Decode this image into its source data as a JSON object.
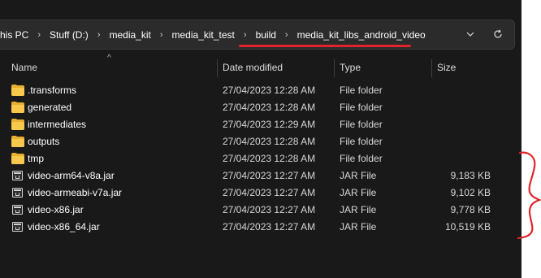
{
  "breadcrumb": {
    "items": [
      "his PC",
      "Stuff (D:)",
      "media_kit",
      "media_kit_test",
      "build",
      "media_kit_libs_android_video"
    ],
    "separator": "›"
  },
  "addressbar": {
    "dropdown_icon": "chevron-down-icon",
    "refresh_icon": "refresh-icon"
  },
  "columns": {
    "name": "Name",
    "date": "Date modified",
    "type": "Type",
    "size": "Size"
  },
  "files": [
    {
      "name": ".transforms",
      "date": "27/04/2023 12:28 AM",
      "type": "File folder",
      "size": "",
      "icon": "folder-icon"
    },
    {
      "name": "generated",
      "date": "27/04/2023 12:28 AM",
      "type": "File folder",
      "size": "",
      "icon": "folder-icon"
    },
    {
      "name": "intermediates",
      "date": "27/04/2023 12:29 AM",
      "type": "File folder",
      "size": "",
      "icon": "folder-icon"
    },
    {
      "name": "outputs",
      "date": "27/04/2023 12:28 AM",
      "type": "File folder",
      "size": "",
      "icon": "folder-icon"
    },
    {
      "name": "tmp",
      "date": "27/04/2023 12:28 AM",
      "type": "File folder",
      "size": "",
      "icon": "folder-icon"
    },
    {
      "name": "video-arm64-v8a.jar",
      "date": "27/04/2023 12:27 AM",
      "type": "JAR File",
      "size": "9,183 KB",
      "icon": "jar-file-icon"
    },
    {
      "name": "video-armeabi-v7a.jar",
      "date": "27/04/2023 12:27 AM",
      "type": "JAR File",
      "size": "9,102 KB",
      "icon": "jar-file-icon"
    },
    {
      "name": "video-x86.jar",
      "date": "27/04/2023 12:27 AM",
      "type": "JAR File",
      "size": "9,778 KB",
      "icon": "jar-file-icon"
    },
    {
      "name": "video-x86_64.jar",
      "date": "27/04/2023 12:27 AM",
      "type": "JAR File",
      "size": "10,519 KB",
      "icon": "jar-file-icon"
    }
  ],
  "colors": {
    "background": "#191919",
    "annotation": "#e0242b",
    "folder": "#f6c94e"
  }
}
